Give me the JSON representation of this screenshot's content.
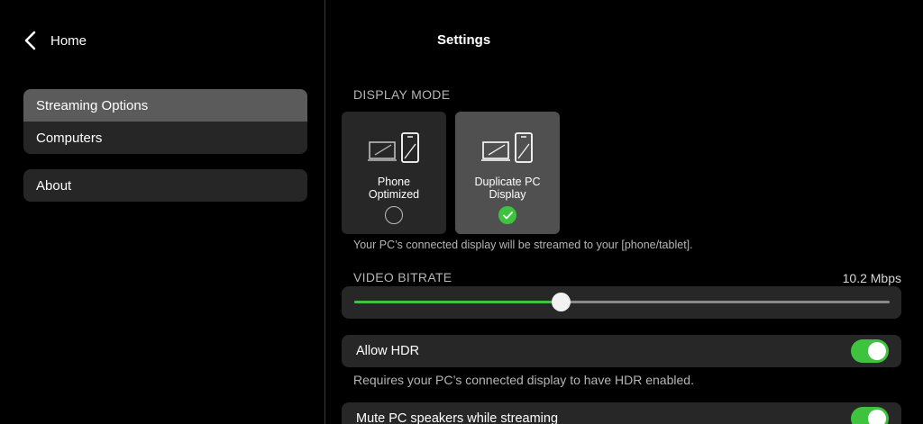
{
  "nav": {
    "home_label": "Home",
    "items": [
      {
        "label": "Streaming Options",
        "active": true
      },
      {
        "label": "Computers",
        "active": false
      },
      {
        "label": "About",
        "active": false
      }
    ]
  },
  "settings": {
    "title": "Settings",
    "display_mode": {
      "label": "DISPLAY MODE",
      "options": [
        {
          "label": "Phone\nOptimized",
          "selected": false
        },
        {
          "label": "Duplicate PC\nDisplay",
          "selected": true
        }
      ],
      "hint": "Your PC’s connected display will be streamed to your [phone/tablet]."
    },
    "video_bitrate": {
      "label": "VIDEO BITRATE",
      "value_text": "10.2 Mbps",
      "position_fraction": 0.386
    },
    "allow_hdr": {
      "label": "Allow HDR",
      "enabled": true,
      "hint": "Requires your PC’s connected display to have HDR enabled."
    },
    "mute_speakers": {
      "label": "Mute PC speakers while streaming",
      "enabled": true
    }
  },
  "colors": {
    "accent": "#3ec33e",
    "background": "#000000",
    "card": "#272727",
    "selected_card": "#505050"
  }
}
